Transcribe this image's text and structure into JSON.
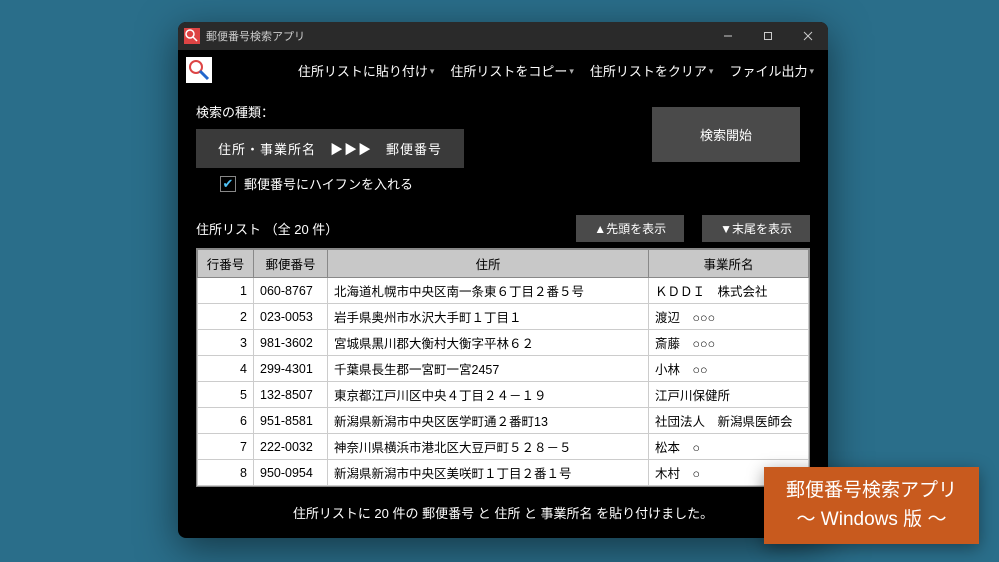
{
  "window": {
    "title": "郵便番号検索アプリ"
  },
  "toolbar": {
    "paste": "住所リストに貼り付け",
    "copy": "住所リストをコピー",
    "clear": "住所リストをクリア",
    "export": "ファイル出力"
  },
  "search": {
    "type_label": "検索の種類：",
    "type_button": "住所・事業所名　▶▶▶　郵便番号",
    "start_button": "検索開始",
    "hyphen_checkbox": "郵便番号にハイフンを入れる",
    "hyphen_checked": true
  },
  "list": {
    "title": "住所リスト （全 20 件）",
    "scroll_top": "▲先頭を表示",
    "scroll_bottom": "▼末尾を表示",
    "columns": {
      "row": "行番号",
      "zip": "郵便番号",
      "address": "住所",
      "office": "事業所名"
    },
    "rows": [
      {
        "n": "1",
        "zip": "060-8767",
        "addr": "北海道札幌市中央区南一条東６丁目２番５号",
        "office": "ＫＤＤＩ　株式会社"
      },
      {
        "n": "2",
        "zip": "023-0053",
        "addr": "岩手県奥州市水沢大手町１丁目１",
        "office": "渡辺　○○○"
      },
      {
        "n": "3",
        "zip": "981-3602",
        "addr": "宮城県黒川郡大衡村大衡字平林６２",
        "office": "斎藤　○○○"
      },
      {
        "n": "4",
        "zip": "299-4301",
        "addr": "千葉県長生郡一宮町一宮2457",
        "office": "小林　○○"
      },
      {
        "n": "5",
        "zip": "132-8507",
        "addr": "東京都江戸川区中央４丁目２４－１９",
        "office": "江戸川保健所"
      },
      {
        "n": "6",
        "zip": "951-8581",
        "addr": "新潟県新潟市中央区医学町通２番町13",
        "office": "社団法人　新潟県医師会"
      },
      {
        "n": "7",
        "zip": "222-0032",
        "addr": "神奈川県横浜市港北区大豆戸町５２８－５",
        "office": "松本　○"
      },
      {
        "n": "8",
        "zip": "950-0954",
        "addr": "新潟県新潟市中央区美咲町１丁目２番１号",
        "office": "木村　○"
      }
    ]
  },
  "status": "住所リストに 20 件の 郵便番号 と 住所 と 事業所名 を貼り付けました。",
  "banner": {
    "line1": "郵便番号検索アプリ",
    "line2": "～ Windows 版 ～"
  }
}
